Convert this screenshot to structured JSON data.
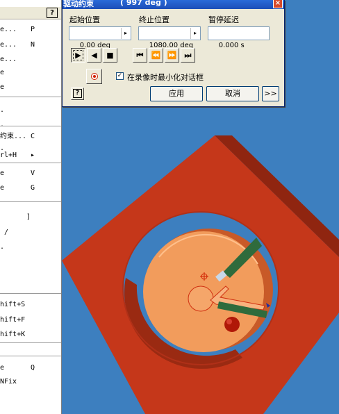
{
  "menu": {
    "help_icon": "?",
    "rows": [
      {
        "label": "e...",
        "key": "P"
      },
      {
        "label": "e...",
        "key": "N"
      },
      {
        "label": "e...",
        "key": ""
      },
      {
        "label": "e",
        "key": ""
      },
      {
        "label": "e",
        "key": ""
      },
      {
        "label": ".",
        "key": ""
      },
      {
        "label": ".",
        "key": ""
      },
      {
        "label": "约束...",
        "key": "C"
      },
      {
        "label": ".",
        "key": ""
      },
      {
        "label": "rl+H",
        "key": "▸"
      },
      {
        "label": "e",
        "key": "V"
      },
      {
        "label": "e",
        "key": "G"
      },
      {
        "label": "",
        "key": "]"
      },
      {
        "label": " /",
        "key": ""
      },
      {
        "label": ".",
        "key": ""
      },
      {
        "label": "hift+S",
        "key": ""
      },
      {
        "label": "hift+F",
        "key": ""
      },
      {
        "label": "hift+K",
        "key": ""
      },
      {
        "label": "e",
        "key": "Q"
      },
      {
        "label": "NFix",
        "key": ""
      }
    ]
  },
  "dialog": {
    "title": "驱动约束",
    "title_angle": "( 997 deg )",
    "close_icon": "×",
    "start_label": "起始位置",
    "start_value": "0.00 deg",
    "end_label": "终止位置",
    "end_value": "1080.00 deg",
    "pause_label": "暂停延迟",
    "pause_value": "0.000 s",
    "spin_icon": "▸",
    "transport": {
      "play_forward": "▶",
      "play_reverse": "◀",
      "stop": "■",
      "to_start": "⏮",
      "step_back": "⏪",
      "step_forward": "⏩",
      "to_end": "⏭"
    },
    "minimize_label": "在录像时最小化对话框",
    "minimize_checked": "✓",
    "help_icon": "?",
    "apply_label": "应用",
    "cancel_label": "取消",
    "more_label": ">>"
  },
  "colors": {
    "viewport_bg": "#3d7fbf",
    "housing": "#c5371a",
    "disc": "#f29c5c",
    "arm": "#2f6b3c",
    "titlebar": "#2a6ad8"
  }
}
